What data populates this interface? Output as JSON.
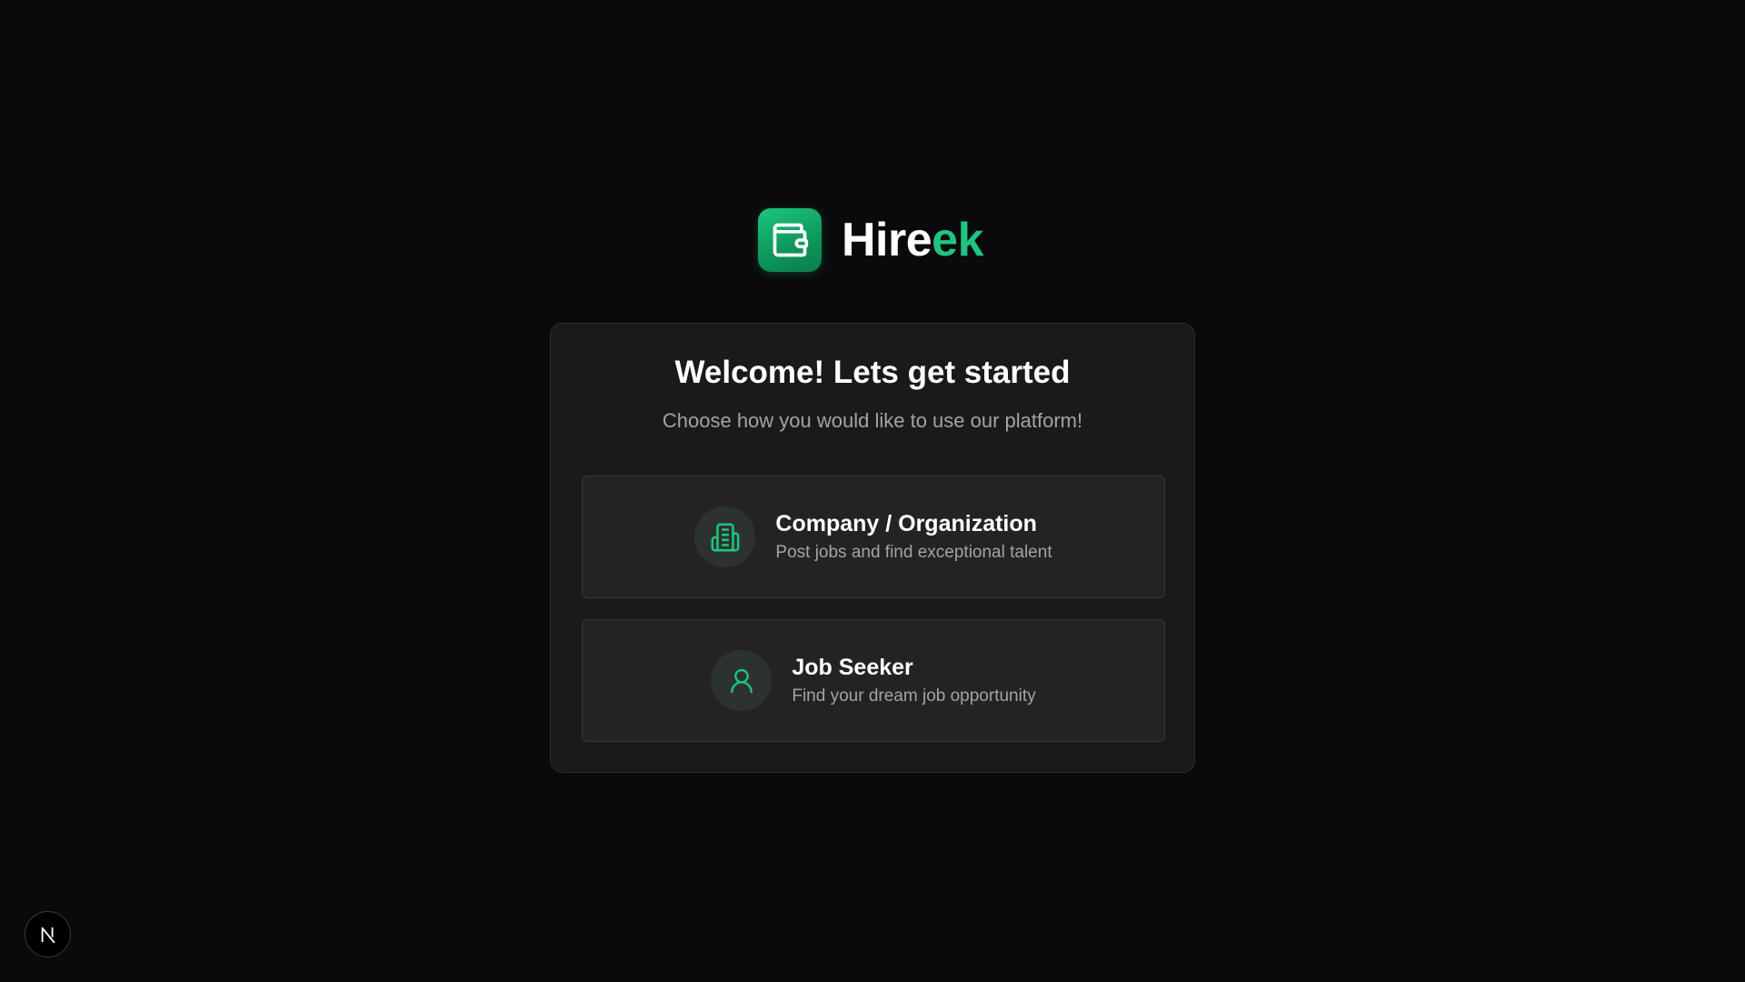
{
  "brand": {
    "name_part1": "Hire",
    "name_part2": "ek",
    "logo_icon": "wallet-icon",
    "accent_color": "#1ec47f"
  },
  "welcome": {
    "title": "Welcome! Lets get started",
    "subtitle": "Choose how you would like to use our platform!"
  },
  "options": [
    {
      "icon": "building-icon",
      "title": "Company / Organization",
      "description": "Post jobs and find exceptional talent"
    },
    {
      "icon": "user-icon",
      "title": "Job Seeker",
      "description": "Find your dream job opportunity"
    }
  ],
  "dev_badge": {
    "letter": "N",
    "icon": "nextjs-icon"
  }
}
